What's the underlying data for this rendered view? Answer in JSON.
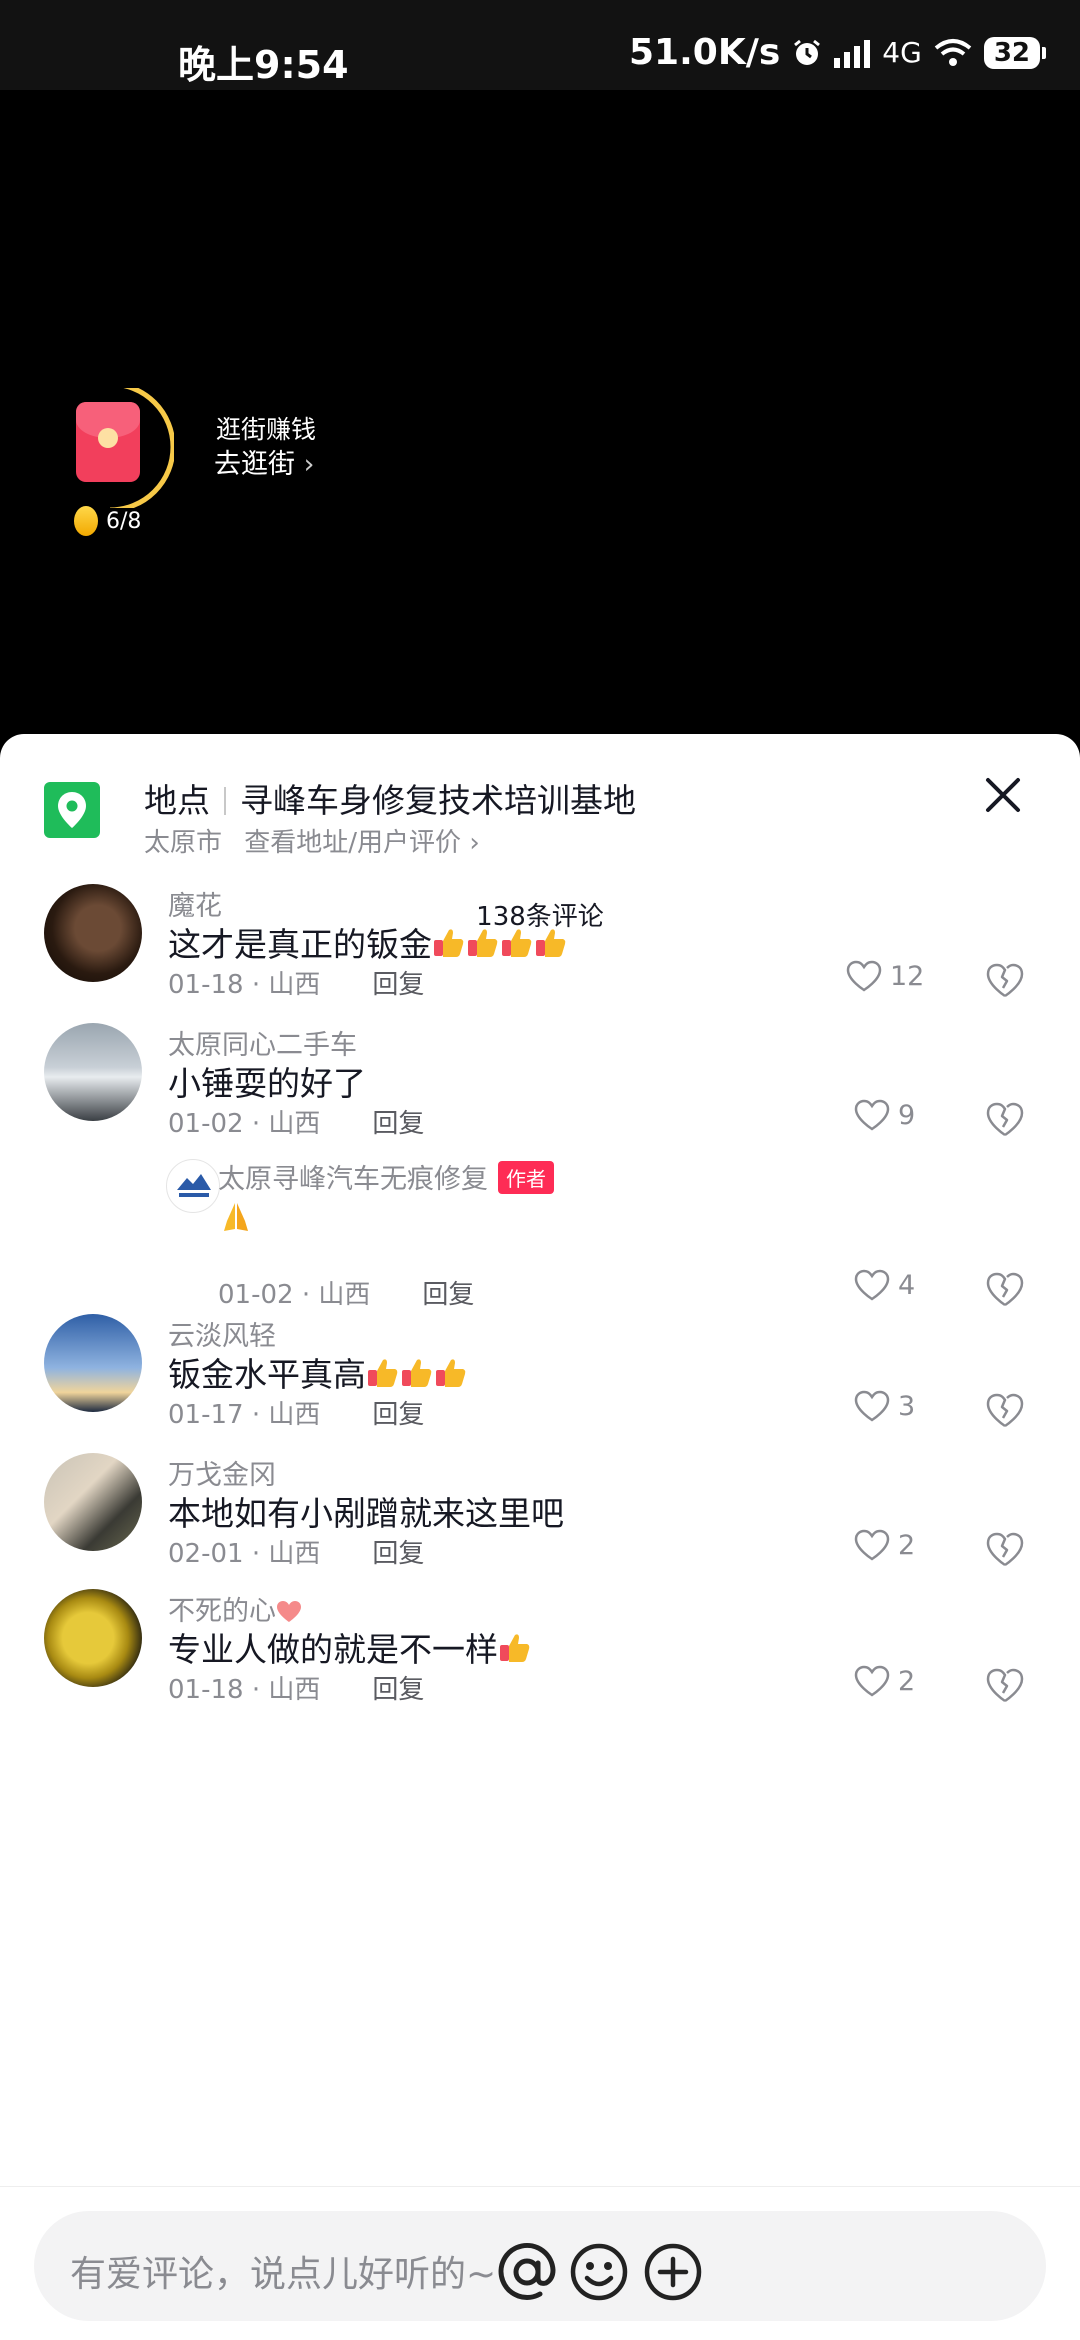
{
  "status_bar": {
    "time": "晚上9:54",
    "net_speed": "51.0K/s",
    "network": "4G",
    "battery": "32"
  },
  "shop_widget": {
    "line1": "逛街赚钱",
    "line2": "去逛街",
    "progress": "6/8"
  },
  "location": {
    "label": "地点",
    "name": "寻峰车身修复技术培训基地",
    "city": "太原市",
    "link": "查看地址/用户评价"
  },
  "comment_count": "138条评论",
  "comments": [
    {
      "name": "魔花",
      "text": "这才是真正的钣金",
      "thumbs": 4,
      "date": "01-18 · 山西",
      "reply": "回复",
      "likes": "12"
    },
    {
      "name": "太原同心二手车",
      "text": "小锤耍的好了",
      "thumbs": 0,
      "date": "01-02 · 山西",
      "reply": "回复",
      "likes": "9"
    },
    {
      "name": "太原寻峰汽车无痕修复",
      "author_tag": "作者",
      "text": "",
      "date": "01-02 · 山西",
      "reply": "回复",
      "likes": "4"
    },
    {
      "name": "云淡风轻",
      "text": "钣金水平真高",
      "thumbs": 3,
      "date": "01-17 · 山西",
      "reply": "回复",
      "likes": "3"
    },
    {
      "name": "万戈金冈",
      "text": "本地如有小剐蹭就来这里吧",
      "thumbs": 0,
      "date": "02-01 · 山西",
      "reply": "回复",
      "likes": "2"
    },
    {
      "name": "不死的心",
      "text": "专业人做的就是不一样",
      "thumbs": 1,
      "date": "01-18 · 山西",
      "reply": "回复",
      "likes": "2"
    }
  ],
  "input": {
    "placeholder": "有爱评论，说点儿好听的~"
  },
  "colors": {
    "accent": "#fe2c55",
    "location_green": "#1fbc5a",
    "sheet_bg": "#ffffff"
  }
}
